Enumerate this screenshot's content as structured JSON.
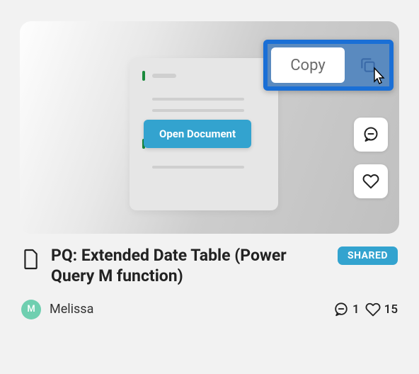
{
  "preview": {
    "open_label": "Open Document",
    "copy_label": "Copy"
  },
  "meta": {
    "title": "PQ: Extended Date Table (Power Query M function)",
    "badge": "SHARED"
  },
  "author": {
    "initial": "M",
    "name": "Melissa"
  },
  "stats": {
    "comments": "1",
    "likes": "15"
  }
}
